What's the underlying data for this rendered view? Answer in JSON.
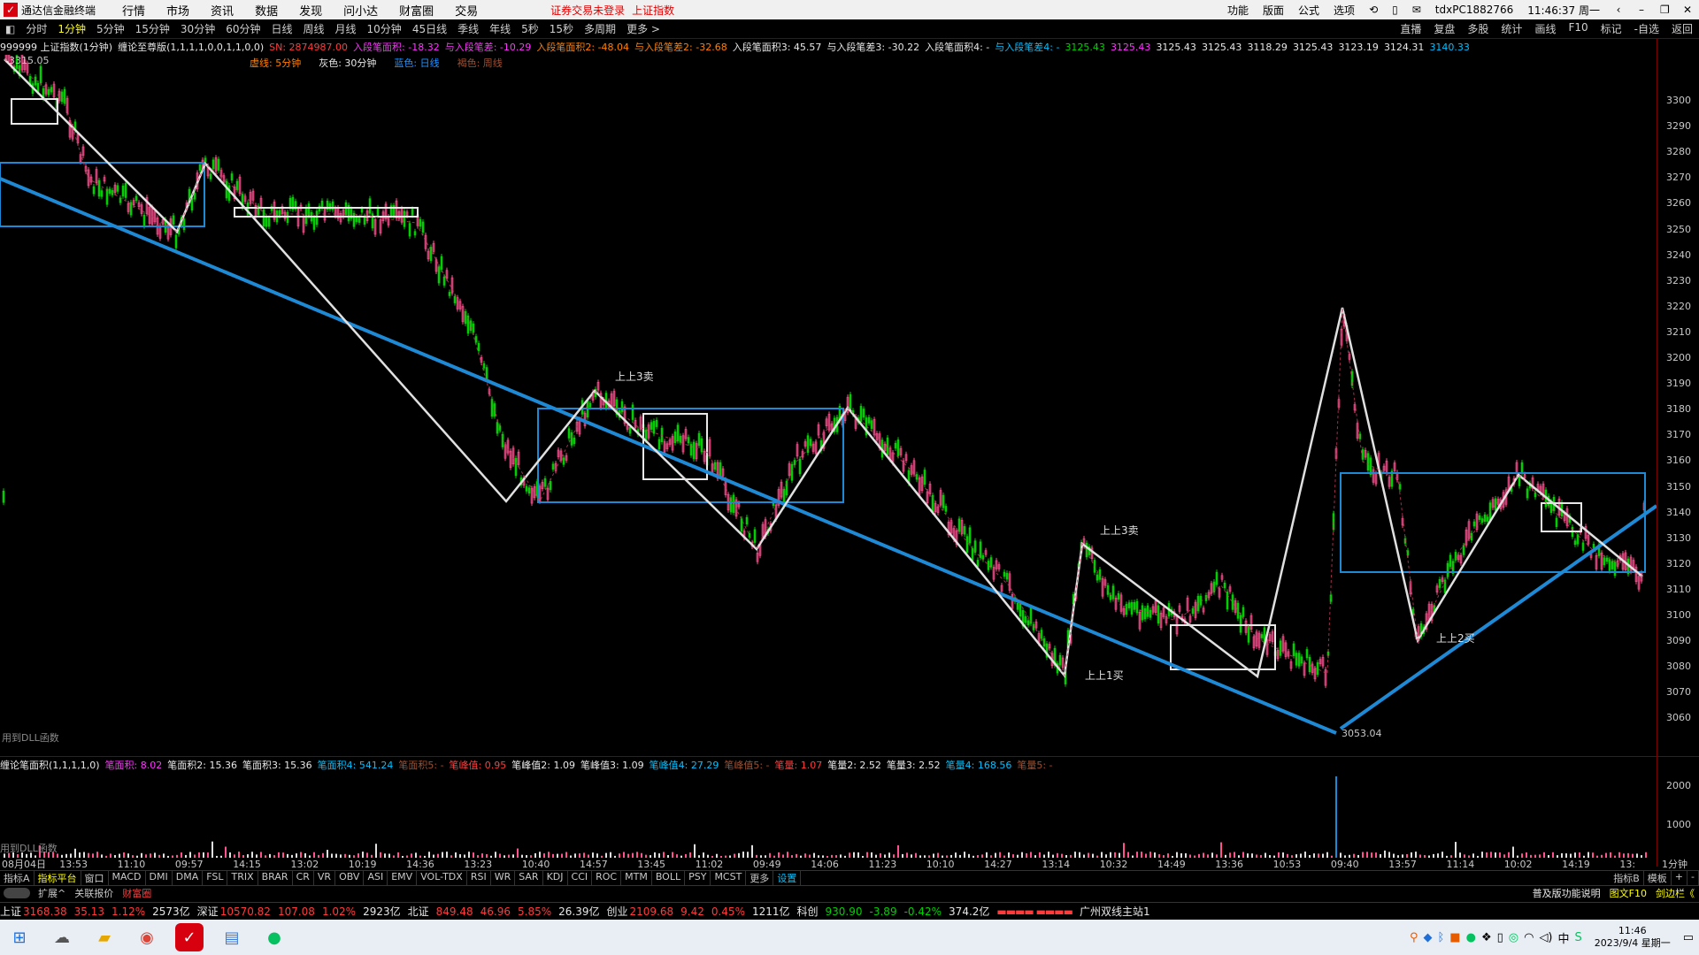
{
  "title": {
    "app_name": "通达信金融终端",
    "menus": [
      "行情",
      "市场",
      "资讯",
      "数据",
      "发现",
      "问小达",
      "财富圈",
      "交易"
    ],
    "warning": "证券交易未登录",
    "index_name": "上证指数",
    "right_items": [
      "功能",
      "版面",
      "公式",
      "选项"
    ],
    "user": "tdxPC1882766",
    "clock": "11:46:37 周一",
    "back_icon": "chevron-left-icon",
    "min_icon": "minimize-icon",
    "max_icon": "restore-icon",
    "close_icon": "close-icon"
  },
  "periods": [
    "分时",
    "1分钟",
    "5分钟",
    "15分钟",
    "30分钟",
    "60分钟",
    "日线",
    "周线",
    "月线",
    "10分钟",
    "45日线",
    "季线",
    "年线",
    "5秒",
    "15秒",
    "多周期",
    "更多 >"
  ],
  "active_period": "1分钟",
  "period_right": [
    "直播",
    "复盘",
    "多股",
    "统计",
    "画线",
    "F10",
    "标记",
    "-自选",
    "返回"
  ],
  "info": {
    "code": "999999 上证指数(1分钟)",
    "indicator": "缠论至尊版(1,1,1,1,0,0,1,1,0,0)",
    "sn": "SN: 2874987.00",
    "ru1": "入段笔面积: -18.32",
    "yu1": "与入段笔差: -10.29",
    "ru2": "入段笔面积2: -48.04",
    "yu2": "与入段笔差2: -32.68",
    "ru3": "入段笔面积3: 45.57",
    "yu3": "与入段笔差3: -30.22",
    "ru4": "入段笔面积4: -",
    "yu4": "与入段笔差4: -",
    "vals": [
      "3125.43",
      "3125.43",
      "3125.43",
      "3125.43",
      "3118.29",
      "3125.43",
      "3123.19",
      "3124.31"
    ],
    "last": "3140.33"
  },
  "legend": {
    "dashed": "虚线: 5分钟",
    "gray": "灰色: 30分钟",
    "blue": "蓝色: 日线",
    "brown": "褐色: 周线"
  },
  "chart_labels": {
    "high": "3315.05",
    "low": "3053.04",
    "sell1": "上上3卖",
    "sell2": "上上3卖",
    "buy1": "上上1买",
    "buy2": "上上2买",
    "dll1": "用到DLL函数",
    "dll2": "用到DLL函数"
  },
  "price_ticks": [
    "3300",
    "3290",
    "3280",
    "3270",
    "3260",
    "3250",
    "3240",
    "3230",
    "3220",
    "3210",
    "3200",
    "3190",
    "3180",
    "3170",
    "3160",
    "3150",
    "3140",
    "3130",
    "3120",
    "3110",
    "3100",
    "3090",
    "3080",
    "3070",
    "3060"
  ],
  "vol_ticks": [
    "2000",
    "1000"
  ],
  "vol_info": {
    "name": "缠论笔面积(1,1,1,1,0)",
    "items": [
      {
        "t": "笔面积: 8.02",
        "c": "mag"
      },
      {
        "t": "笔面积2: 15.36",
        "c": "wht"
      },
      {
        "t": "笔面积3: 15.36",
        "c": "wht"
      },
      {
        "t": "笔面积4: 541.24",
        "c": "cyn"
      },
      {
        "t": "笔面积5: -",
        "c": "brn"
      },
      {
        "t": "笔峰值: 0.95",
        "c": "red"
      },
      {
        "t": "笔峰值2: 1.09",
        "c": "wht"
      },
      {
        "t": "笔峰值3: 1.09",
        "c": "wht"
      },
      {
        "t": "笔峰值4: 27.29",
        "c": "cyn"
      },
      {
        "t": "笔峰值5: -",
        "c": "brn"
      },
      {
        "t": "笔量: 1.07",
        "c": "red"
      },
      {
        "t": "笔量2: 2.52",
        "c": "wht"
      },
      {
        "t": "笔量3: 2.52",
        "c": "wht"
      },
      {
        "t": "笔量4: 168.56",
        "c": "cyn"
      },
      {
        "t": "笔量5: -",
        "c": "brn"
      }
    ]
  },
  "time_labels": [
    "08月04日",
    "13:53",
    "11:10",
    "09:57",
    "14:15",
    "13:02",
    "10:19",
    "14:36",
    "13:23",
    "10:40",
    "14:57",
    "13:45",
    "11:02",
    "09:49",
    "14:06",
    "11:23",
    "10:10",
    "14:27",
    "13:14",
    "10:32",
    "14:49",
    "13:36",
    "10:53",
    "09:40",
    "13:57",
    "11:14",
    "10:02",
    "14:19",
    "13:"
  ],
  "period_label": "1分钟",
  "indicators": [
    "指标A",
    "指标平台",
    "窗口",
    "MACD",
    "DMI",
    "DMA",
    "FSL",
    "TRIX",
    "BRAR",
    "CR",
    "VR",
    "OBV",
    "ASI",
    "EMV",
    "VOL-TDX",
    "RSI",
    "WR",
    "SAR",
    "KDJ",
    "CCI",
    "ROC",
    "MTM",
    "BOLL",
    "PSY",
    "MCST",
    "更多",
    "设置"
  ],
  "indicators_right": [
    "指标B",
    "模板",
    "+",
    "-"
  ],
  "ext": [
    "扩展^",
    "关联报价",
    "财富圈"
  ],
  "ext_right": [
    "普及版功能说明",
    "图文F10",
    "剑边栏《"
  ],
  "status": {
    "sh_label": "上证",
    "sh_val": "3168.38",
    "sh_chg": "35.13",
    "sh_pct": "1.12%",
    "sh_amt": "2573亿",
    "sz_label": "深证",
    "sz_val": "10570.82",
    "sz_chg": "107.08",
    "sz_pct": "1.02%",
    "sz_amt": "2923亿",
    "bx_label": "北证",
    "bx_val": "849.48",
    "bx_chg": "46.96",
    "bx_pct": "5.85%",
    "bx_amt": "26.39亿",
    "cy_label": "创业",
    "cy_val": "2109.68",
    "cy_chg": "9.42",
    "cy_pct": "0.45%",
    "cy_amt": "1211亿",
    "kc_label": "科创",
    "kc_val": "930.90",
    "kc_chg": "-3.89",
    "kc_pct": "-0.42%",
    "kc_amt": "374.2亿",
    "station": "广州双线主站1"
  },
  "taskbar": {
    "time": "11:46",
    "date": "2023/9/4 星期一",
    "ime": "中"
  }
}
